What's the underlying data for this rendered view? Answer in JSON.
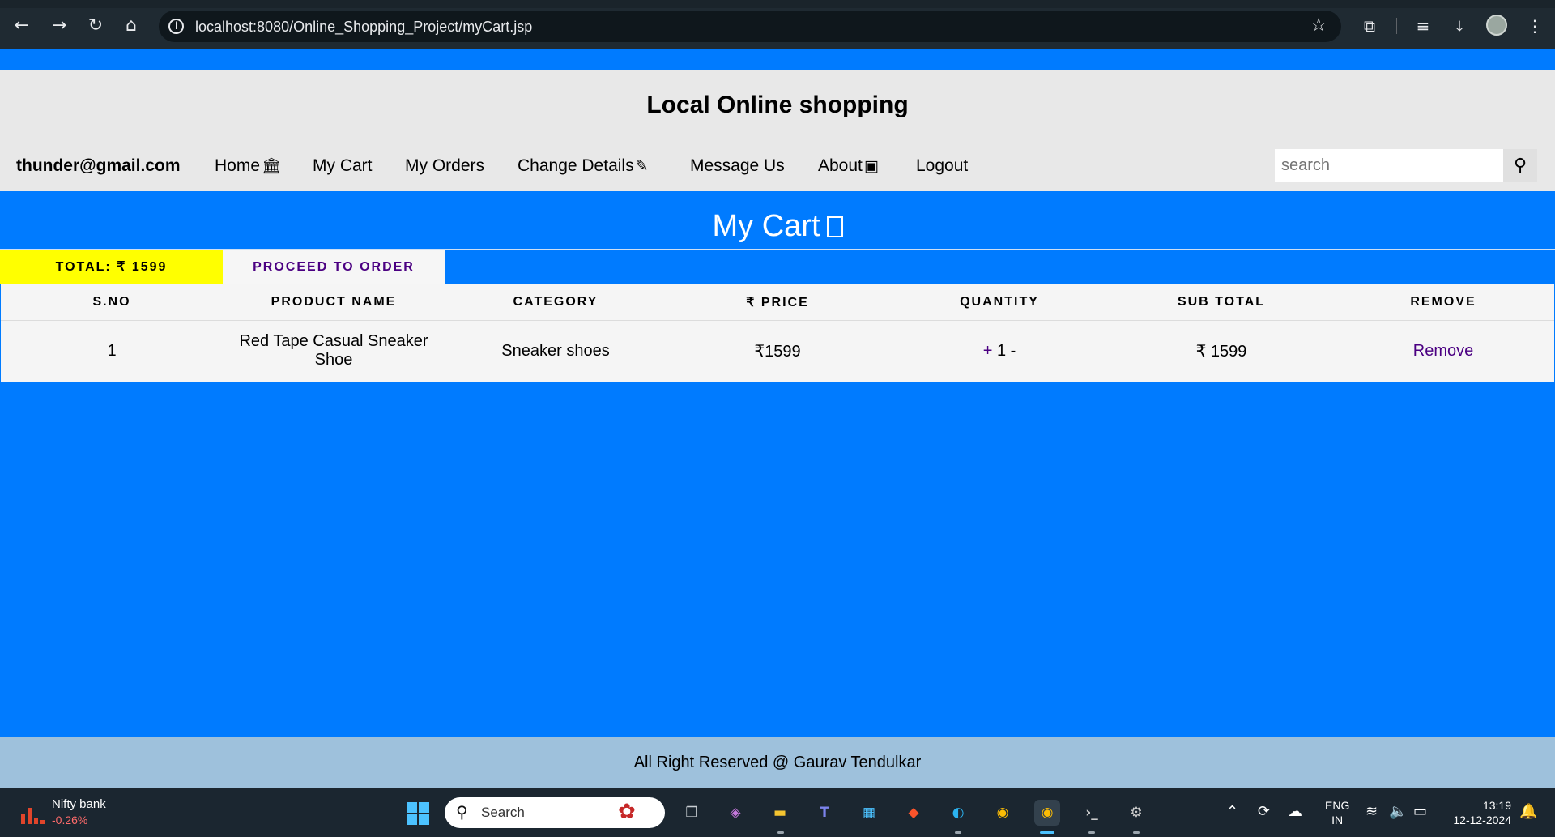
{
  "browser": {
    "url": "localhost:8080/Online_Shopping_Project/myCart.jsp"
  },
  "header": {
    "site_title": "Local Online shopping",
    "user_email": "thunder@gmail.com",
    "nav": [
      {
        "label": "Home",
        "icon": "bank-icon"
      },
      {
        "label": "My Cart"
      },
      {
        "label": "My Orders"
      },
      {
        "label": "Change Details",
        "icon": "edit-icon"
      },
      {
        "label": "Message Us"
      },
      {
        "label": "About",
        "icon": "address-book-icon"
      },
      {
        "label": "Logout"
      }
    ],
    "search_placeholder": "search"
  },
  "cart": {
    "title": "My Cart",
    "total_label": "TOTAL: ₹ 1599",
    "proceed_label": "PROCEED TO ORDER",
    "columns": [
      "S.NO",
      "PRODUCT NAME",
      "CATEGORY",
      "₹ PRICE",
      "QUANTITY",
      "SUB TOTAL",
      "REMOVE"
    ],
    "rows": [
      {
        "sno": "1",
        "product": "Red Tape Casual Sneaker Shoe",
        "category": "Sneaker shoes",
        "price": "₹1599",
        "qty_plus": "+",
        "qty": "1",
        "qty_minus": "-",
        "subtotal": "₹ 1599",
        "remove": "Remove"
      }
    ]
  },
  "footer": {
    "text": "All Right Reserved @ Gaurav Tendulkar"
  },
  "taskbar": {
    "widget_name": "Nifty bank",
    "widget_value": "-0.26%",
    "search_label": "Search",
    "lang_line1": "ENG",
    "lang_line2": "IN",
    "time": "13:19",
    "date": "12-12-2024"
  },
  "colors": {
    "page_bg": "#007bff",
    "header_bg": "#e8e8e8",
    "total_bg": "#ffff00",
    "link": "#4b0082",
    "footer_bg": "#9ec1dc",
    "taskbar_bg": "#1b2630"
  }
}
